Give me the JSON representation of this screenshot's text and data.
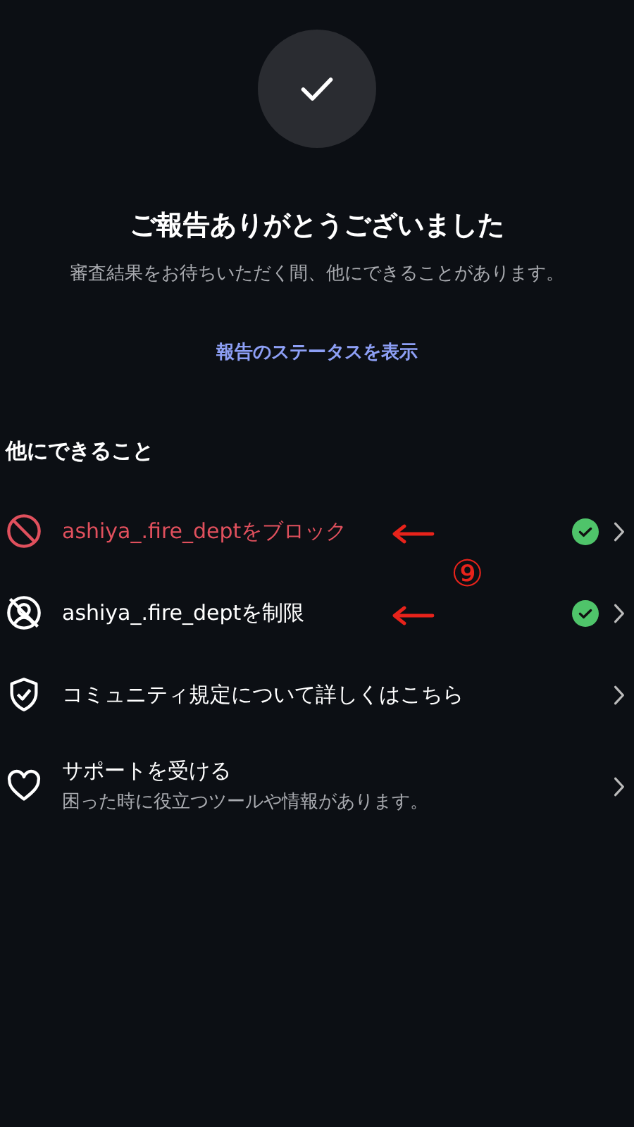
{
  "header": {
    "title": "ご報告ありがとうございました",
    "subtitle": "審査結果をお待ちいただく間、他にできることがあります。",
    "status_link": "報告のステータスを表示"
  },
  "section_title": "他にできること",
  "options": [
    {
      "kind": "block",
      "title": "ashiya_.fire_deptをブロック",
      "danger": true,
      "done": true,
      "marked": true
    },
    {
      "kind": "restrict",
      "title": "ashiya_.fire_deptを制限",
      "danger": false,
      "done": true,
      "marked": true
    },
    {
      "kind": "guidelines",
      "title": "コミュニティ規定について詳しくはこちら",
      "danger": false,
      "done": false,
      "marked": false
    },
    {
      "kind": "support",
      "title": "サポートを受ける",
      "subtitle": "困った時に役立つツールや情報があります。",
      "danger": false,
      "done": false,
      "marked": false
    }
  ],
  "annotation_label": "⑨"
}
